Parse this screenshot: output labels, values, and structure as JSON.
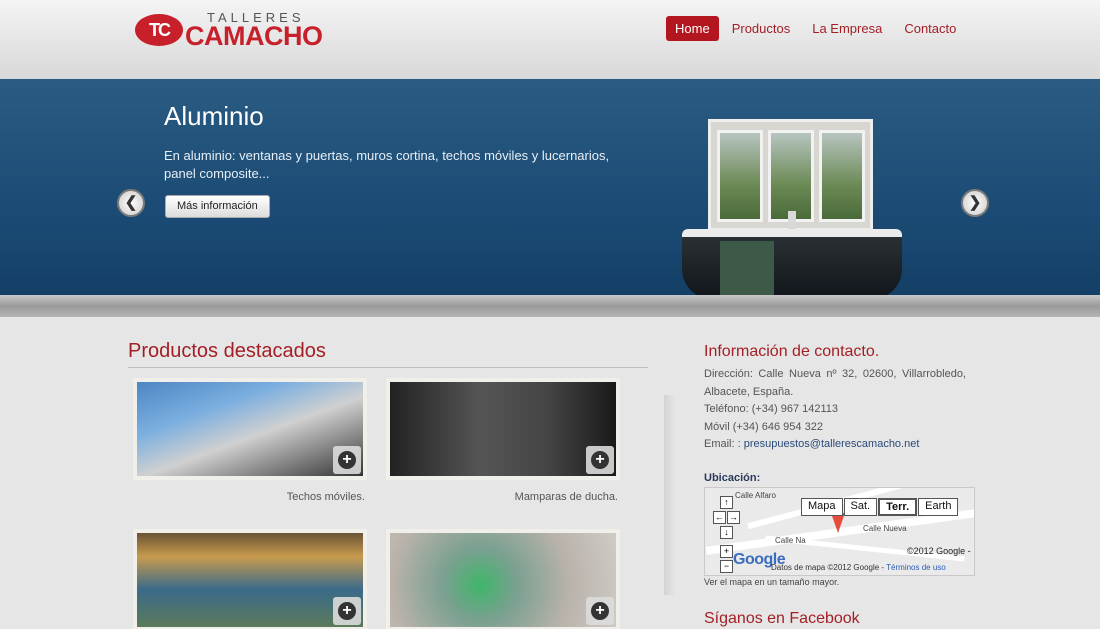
{
  "brand": {
    "mark": "TC",
    "small": "TALLERES",
    "big": "CAMACHO",
    "color": "#c8202a"
  },
  "nav": [
    {
      "label": "Home",
      "active": true
    },
    {
      "label": "Productos"
    },
    {
      "label": "La Empresa"
    },
    {
      "label": "Contacto"
    }
  ],
  "slide": {
    "title": "Aluminio",
    "text": "En aluminio: ventanas y puertas, muros cortina, techos móviles y lucernarios, panel composite...",
    "button": "Más información",
    "prev": "❮",
    "next": "❯"
  },
  "products": {
    "title": "Productos destacados",
    "items": [
      {
        "caption": "Techos móviles.",
        "icon": "plus-icon"
      },
      {
        "caption": "Mamparas de ducha.",
        "icon": "plus-icon"
      },
      {
        "caption": "",
        "icon": "plus-icon"
      },
      {
        "caption": "",
        "icon": "plus-icon"
      }
    ],
    "plus_glyph": "+"
  },
  "contact": {
    "title": "Información de contacto.",
    "address": "Dirección: Calle Nueva nº 32, 02600, Villarrobledo, Albacete, España.",
    "phone": "Teléfono: (+34) 967 142113",
    "mobile": "Móvil (+34) 646 954 322",
    "email_label": "Email: :",
    "email": "presupuestos@tallerescamacho.net"
  },
  "location": {
    "title": "Ubicación:",
    "map_buttons": [
      "Mapa",
      "Sat.",
      "Terr.",
      "Earth"
    ],
    "street_labels": [
      "Calle Alfaro",
      "Calle Nueva",
      "Calle Na"
    ],
    "google": "Google",
    "copyright": "©2012 Google -",
    "map_data": "Datos de mapa ©2012 Google -",
    "terms": "Términos de uso",
    "link": "Ver el mapa en un tamaño mayor."
  },
  "facebook": {
    "title": "Síganos en Facebook"
  },
  "colors": {
    "accent": "#a31f26",
    "nav_active": "#b3161f",
    "slider": "#1a4a73"
  }
}
